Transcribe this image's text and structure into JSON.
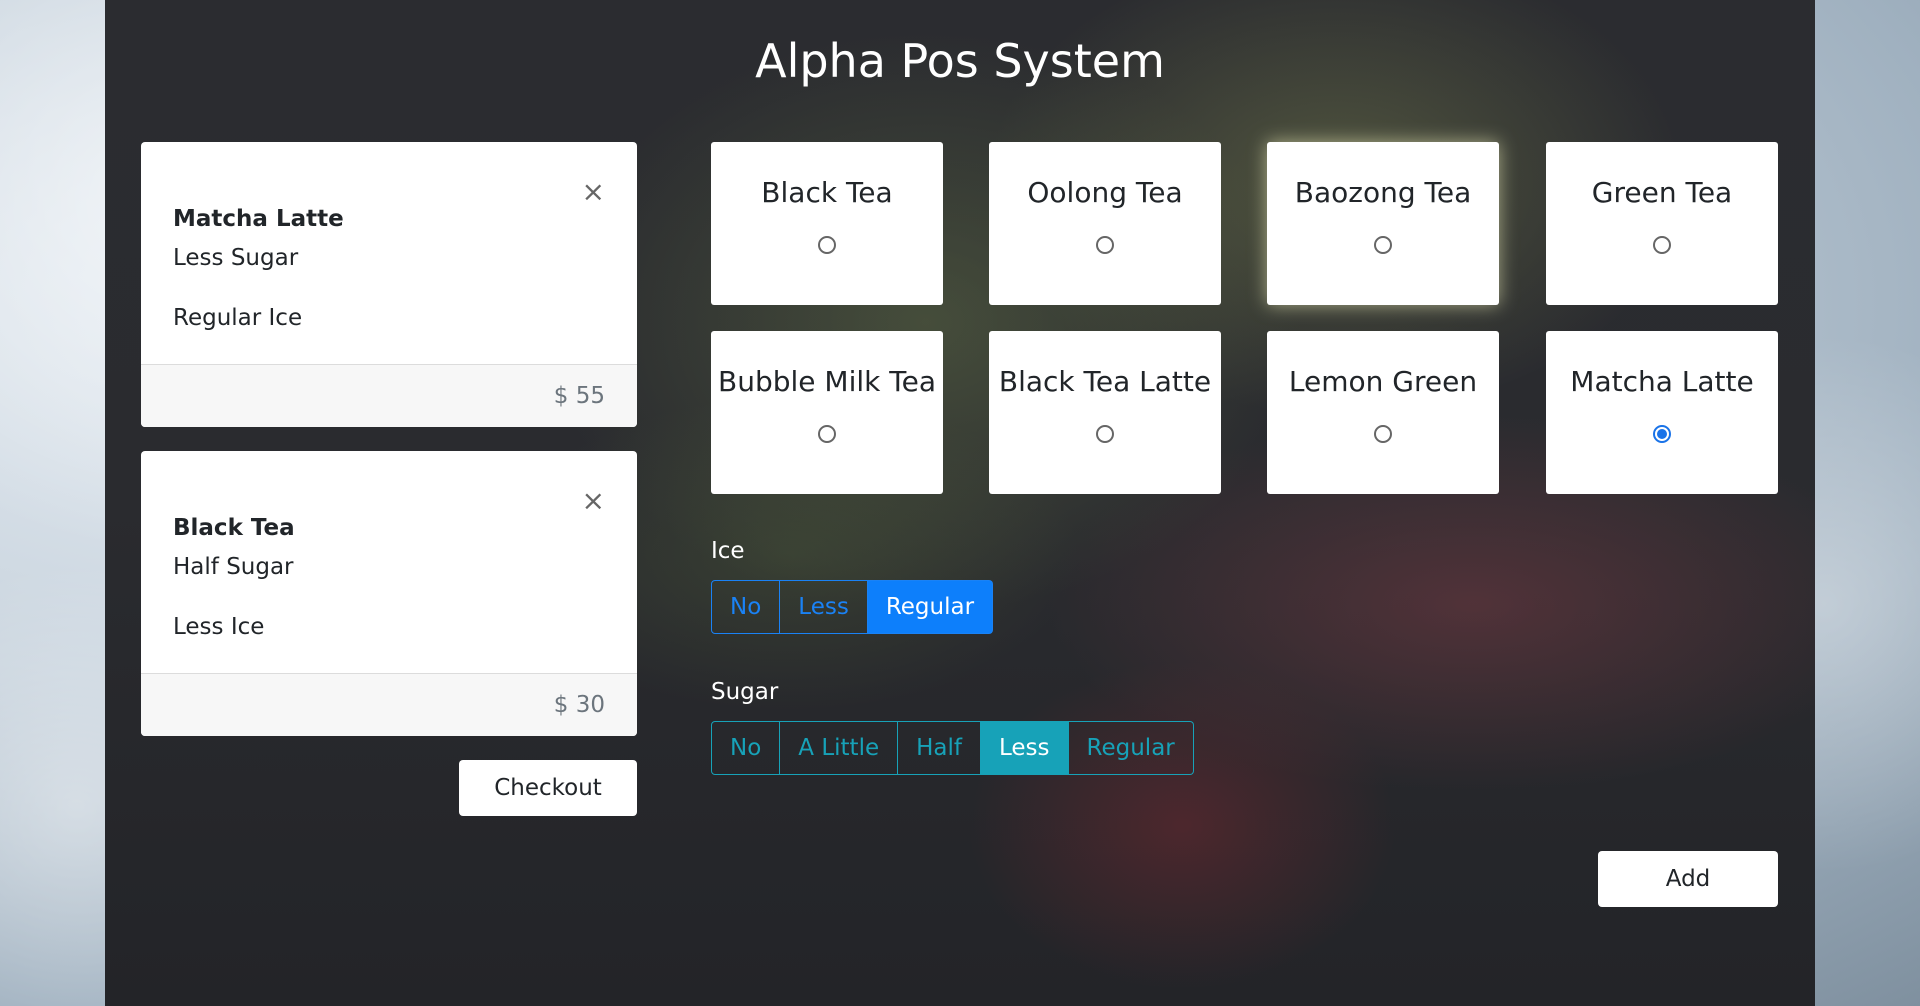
{
  "app": {
    "title": "Alpha Pos System"
  },
  "cart": {
    "items": [
      {
        "name": "Matcha Latte",
        "sugar": "Less Sugar",
        "ice": "Regular Ice",
        "price": "$ 55"
      },
      {
        "name": "Black Tea",
        "sugar": "Half Sugar",
        "ice": "Less Ice",
        "price": "$ 30"
      }
    ],
    "close_symbol": "×",
    "checkout_label": "Checkout"
  },
  "drinks": [
    {
      "name": "Black Tea",
      "selected": false
    },
    {
      "name": "Oolong Tea",
      "selected": false
    },
    {
      "name": "Baozong Tea",
      "selected": false
    },
    {
      "name": "Green Tea",
      "selected": false
    },
    {
      "name": "Bubble Milk Tea",
      "selected": false
    },
    {
      "name": "Black Tea Latte",
      "selected": false
    },
    {
      "name": "Lemon Green",
      "selected": false
    },
    {
      "name": "Matcha Latte",
      "selected": true
    }
  ],
  "ice": {
    "label": "Ice",
    "options": [
      "No",
      "Less",
      "Regular"
    ],
    "selected": "Regular"
  },
  "sugar": {
    "label": "Sugar",
    "options": [
      "No",
      "A Little",
      "Half",
      "Less",
      "Regular"
    ],
    "selected": "Less"
  },
  "add_label": "Add",
  "colors": {
    "ice_accent": "#0d7ffb",
    "sugar_accent": "#17a2b8",
    "radio_checked": "#1a73e8"
  }
}
